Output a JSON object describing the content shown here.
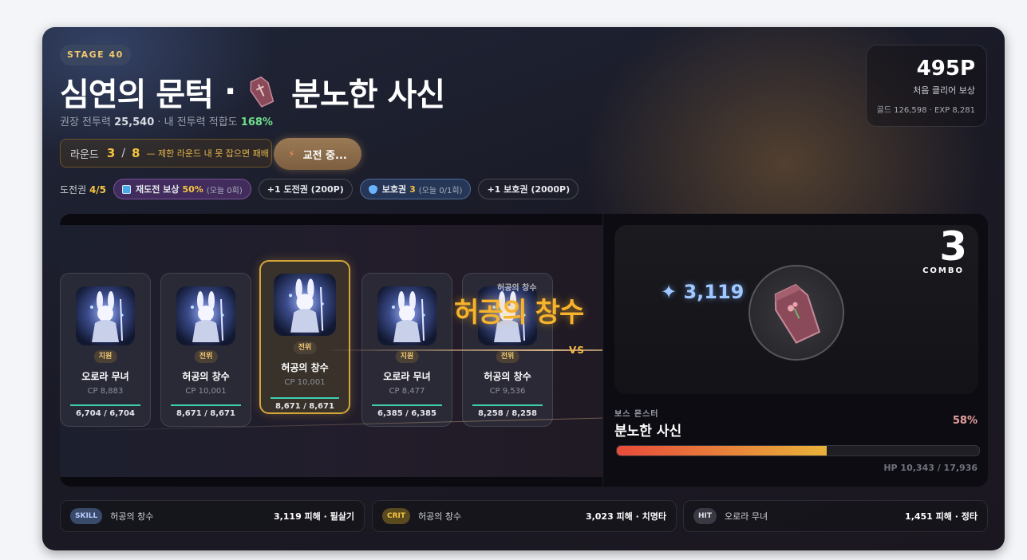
{
  "stage": {
    "badge": "STAGE 40"
  },
  "title": {
    "area": "심연의 문턱",
    "dot": "·",
    "boss": "분노한 사신"
  },
  "subtitle": {
    "rec_label": "권장 전투력",
    "rec_value": "25,540",
    "sep": "· 내 전투력 적합도",
    "fit": "168%"
  },
  "reward": {
    "points": "495P",
    "label": "처음 클리어 보상",
    "detail": "골드 126,598 · EXP 8,281"
  },
  "round": {
    "label": "라운드",
    "current": "3",
    "sep": "/",
    "total": "8",
    "warning": "— 제한 라운드 내 못 잡으면 패배"
  },
  "fight_button": {
    "label": "교전 중..."
  },
  "tickets": {
    "label": "도전권",
    "value": "4/5",
    "retry": {
      "label": "재도전 보상",
      "value": "50%",
      "note": "(오늘 0회)"
    },
    "buy_ticket": "+1 도전권 (200P)",
    "shield": {
      "label": "보호권",
      "value": "3",
      "note": "(오늘 0/1회)"
    },
    "buy_shield": "+1 보호권 (2000P)"
  },
  "party": [
    {
      "role": "지원",
      "name": "오로라 무녀",
      "cp": "CP 8,883",
      "hp": "6,704 / 6,704",
      "hp_frac": 1.0
    },
    {
      "role": "전위",
      "name": "허공의 창수",
      "cp": "CP 10,001",
      "hp": "8,671 / 8,671",
      "hp_frac": 1.0
    },
    {
      "role": "전위",
      "name": "허공의 창수",
      "cp": "CP 10,001",
      "hp": "8,671 / 8,671",
      "hp_frac": 1.0
    },
    {
      "role": "지원",
      "name": "오로라 무녀",
      "cp": "CP 8,477",
      "hp": "6,385 / 6,385",
      "hp_frac": 1.0
    },
    {
      "role": "전위",
      "name": "허공의 창수",
      "cp": "CP 9,536",
      "hp": "8,258 / 8,258",
      "hp_frac": 1.0
    }
  ],
  "battle": {
    "skill_small": "허공의 창수",
    "skill_big": "허공의 창수",
    "vs": "VS",
    "damage": "✦ 3,119",
    "combo_count": "3",
    "combo_label": "COMBO"
  },
  "boss": {
    "type": "보스 몬스터",
    "name": "분노한 사신",
    "pct": "58%",
    "hp_frac": 0.58,
    "hp": "HP 10,343 / 17,936"
  },
  "logs": [
    {
      "tag": "SKILL",
      "name": "허공의 창수",
      "result": "3,119 피해 · 필살기",
      "tag_color": "#3a4a6a",
      "tag_text": "#b9ccff"
    },
    {
      "tag": "CRIT",
      "name": "허공의 창수",
      "result": "3,023 피해 · 치명타",
      "tag_color": "#5a4a1e",
      "tag_text": "#f5c542"
    },
    {
      "tag": "HIT",
      "name": "오로라 무녀",
      "result": "1,451 피해 · 정타",
      "tag_color": "#3a3a44",
      "tag_text": "#e0e2e8"
    }
  ],
  "colors": {
    "accent": "#f5c542",
    "hp_green": "#3fd0b0",
    "fit_green": "#6fe08d"
  }
}
